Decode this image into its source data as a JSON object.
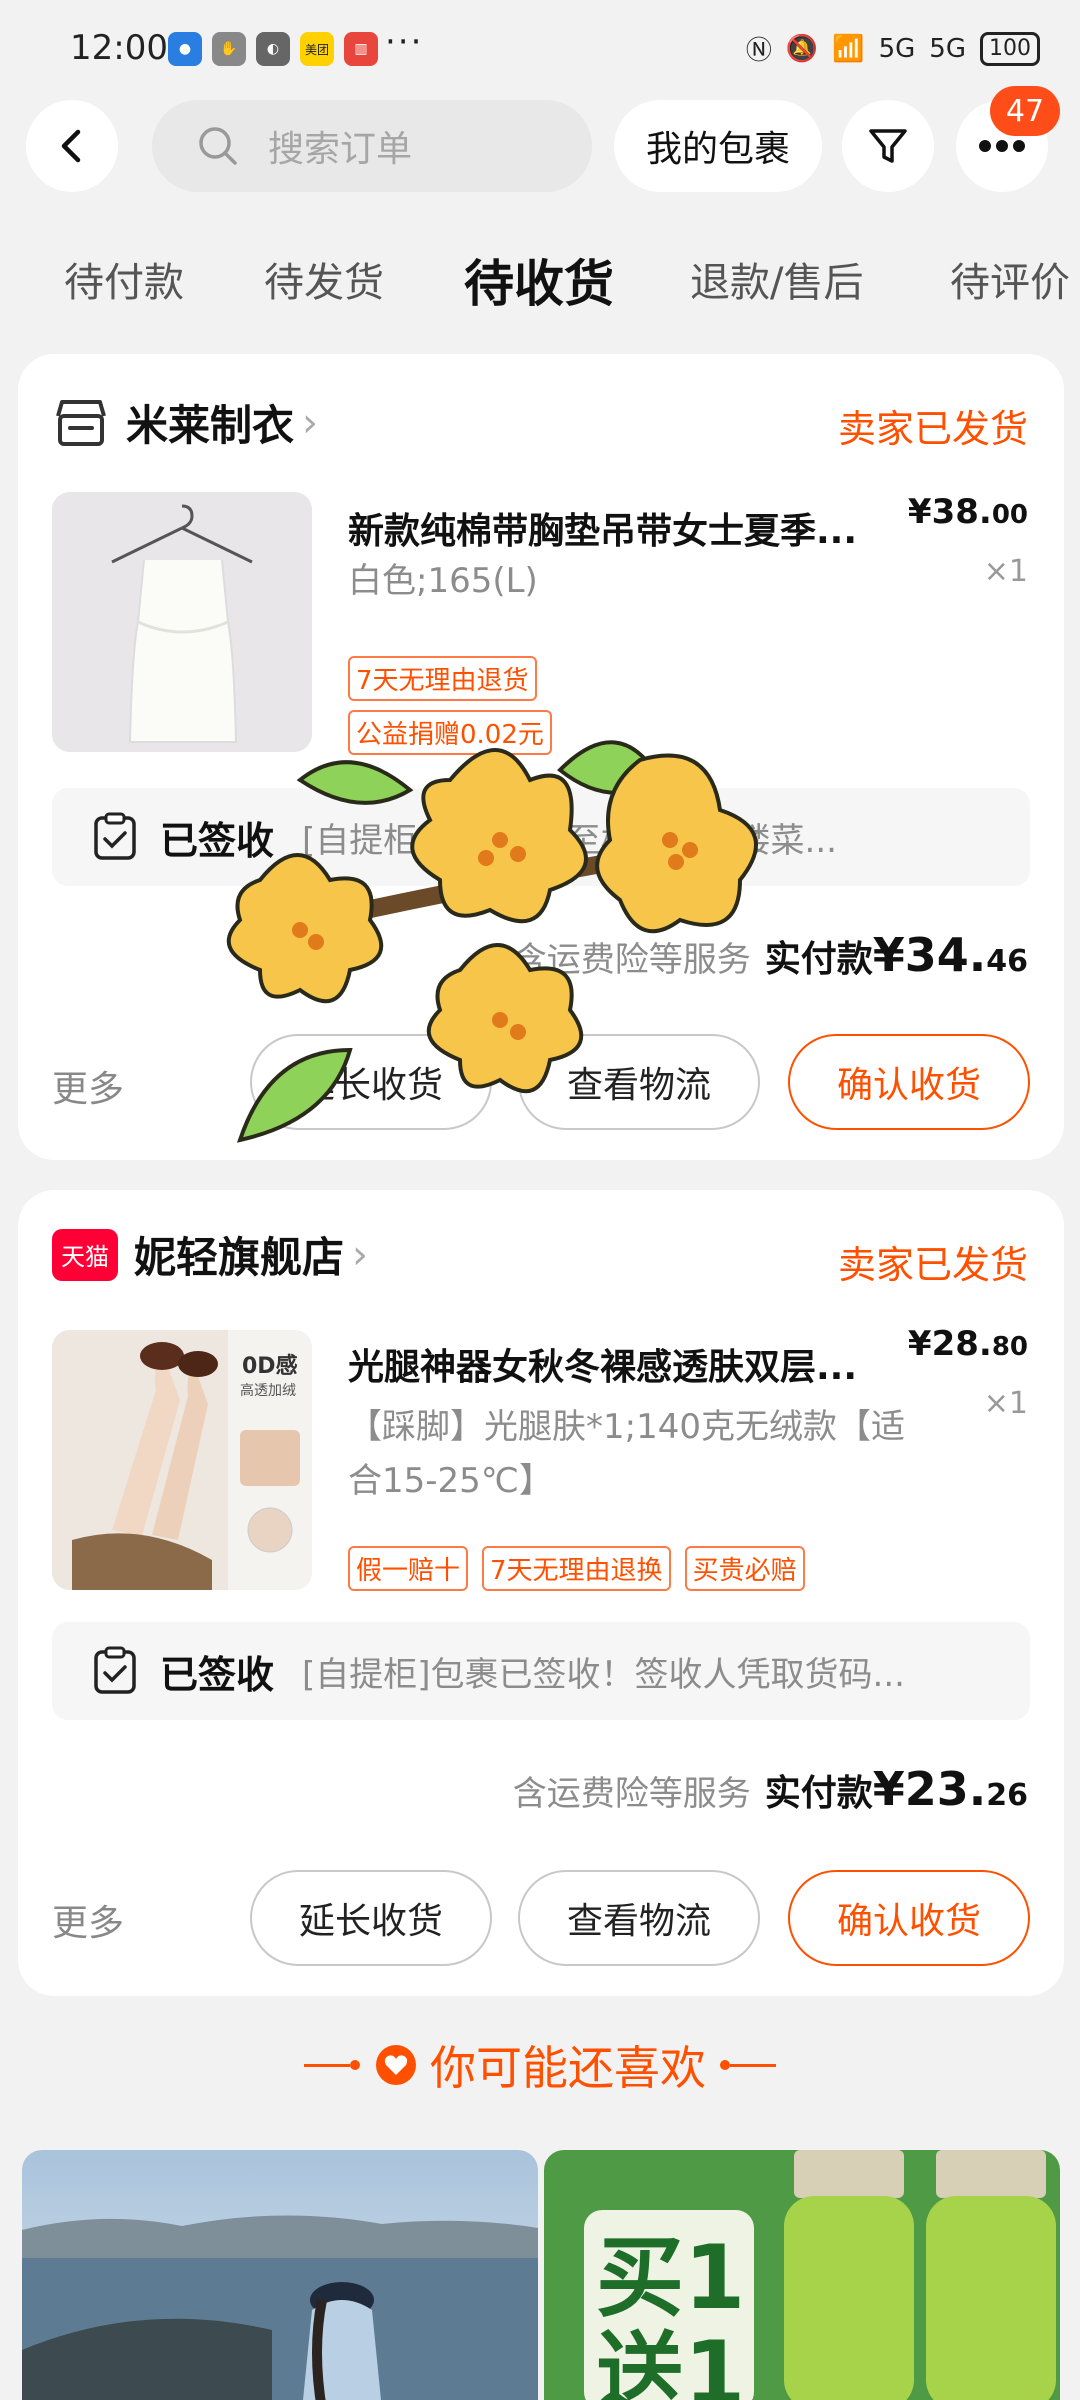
{
  "status": {
    "time": "12:00",
    "battery": "100",
    "net1": "5G",
    "net2": "5G",
    "app_meituan": "美团"
  },
  "header": {
    "search_placeholder": "搜索订单",
    "my_package": "我的包裹",
    "badge_count": "47"
  },
  "tabs": [
    {
      "label": "待付款"
    },
    {
      "label": "待发货"
    },
    {
      "label": "待收货"
    },
    {
      "label": "退款/售后"
    },
    {
      "label": "待评价"
    }
  ],
  "orders": [
    {
      "shop": "米莱制衣",
      "status": "卖家已发货",
      "title": "新款纯棉带胸垫吊带女士夏季...",
      "spec": "白色;165(L)",
      "price_int": "¥38.",
      "price_dec": "00",
      "qty": "×1",
      "tags": [
        "7天无理由退货",
        "公益捐赠0.02元"
      ],
      "log_title": "已签收",
      "log_text": "[自提柜]包裹已送至校区钟萃楼菜...",
      "pay_note": "含运费险等服务",
      "pay_label": "实付款",
      "pay_int": "¥34.",
      "pay_dec": "46",
      "more": "更多",
      "btn1": "延长收货",
      "btn2": "查看物流",
      "btn3": "确认收货"
    },
    {
      "shop": "妮轻旗舰店",
      "shop_badge": "天猫",
      "status": "卖家已发货",
      "title": "光腿神器女秋冬裸感透肤双层...",
      "spec": "【踩脚】光腿肤*1;140克无绒款【适合15-25℃】",
      "price_int": "¥28.",
      "price_dec": "80",
      "qty": "×1",
      "tags": [
        "假一赔十",
        "7天无理由退换",
        "买贵必赔"
      ],
      "thumb_text1": "0D感",
      "thumb_text2": "高透加绒",
      "log_title": "已签收",
      "log_text": "[自提柜]包裹已签收！签收人凭取货码...",
      "pay_note": "含运费险等服务",
      "pay_label": "实付款",
      "pay_int": "¥23.",
      "pay_dec": "26",
      "more": "更多",
      "btn1": "延长收货",
      "btn2": "查看物流",
      "btn3": "确认收货"
    }
  ],
  "recommend": {
    "title": "你可能还喜欢",
    "promo_text": "买1送1"
  },
  "colors": {
    "accent": "#ff5000",
    "bg": "#f2f2f2"
  }
}
